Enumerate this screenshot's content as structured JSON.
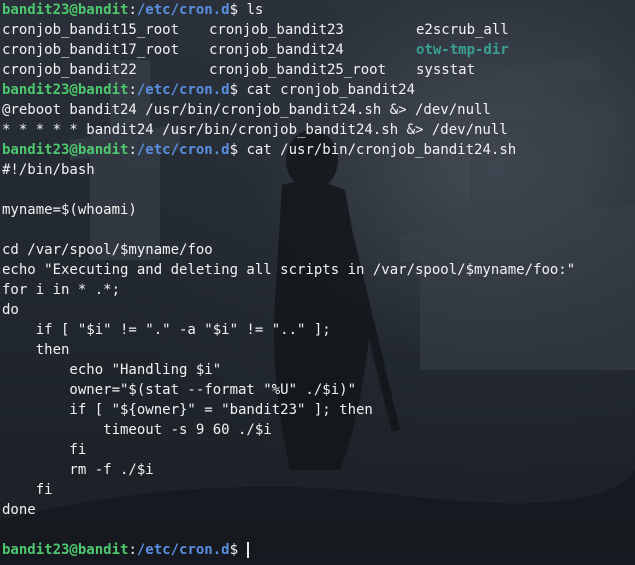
{
  "prompt": {
    "user": "bandit23@bandit",
    "sep": ":",
    "path": "/etc/cron.d",
    "sigil": "$ "
  },
  "commands": {
    "ls": "ls",
    "cat_crontab": "cat cronjob_bandit24",
    "cat_script": "cat /usr/bin/cronjob_bandit24.sh"
  },
  "ls_rows": [
    [
      "cronjob_bandit15_root",
      "cronjob_bandit23",
      "e2scrub_all"
    ],
    [
      "cronjob_bandit17_root",
      "cronjob_bandit24",
      "otw-tmp-dir"
    ],
    [
      "cronjob_bandit22",
      "cronjob_bandit25_root",
      "sysstat"
    ]
  ],
  "directory_entry": "otw-tmp-dir",
  "crontab_lines": [
    "@reboot bandit24 /usr/bin/cronjob_bandit24.sh &> /dev/null",
    "* * * * * bandit24 /usr/bin/cronjob_bandit24.sh &> /dev/null"
  ],
  "script_lines": [
    "#!/bin/bash",
    "",
    "myname=$(whoami)",
    "",
    "cd /var/spool/$myname/foo",
    "echo \"Executing and deleting all scripts in /var/spool/$myname/foo:\"",
    "for i in * .*;",
    "do",
    "    if [ \"$i\" != \".\" -a \"$i\" != \"..\" ];",
    "    then",
    "        echo \"Handling $i\"",
    "        owner=\"$(stat --format \"%U\" ./$i)\"",
    "        if [ \"${owner}\" = \"bandit23\" ]; then",
    "            timeout -s 9 60 ./$i",
    "        fi",
    "        rm -f ./$i",
    "    fi",
    "done",
    ""
  ],
  "colors": {
    "user": "#4ec86e",
    "path": "#5a8fe0",
    "dir": "#3aa090",
    "text": "#f2f2f2"
  }
}
